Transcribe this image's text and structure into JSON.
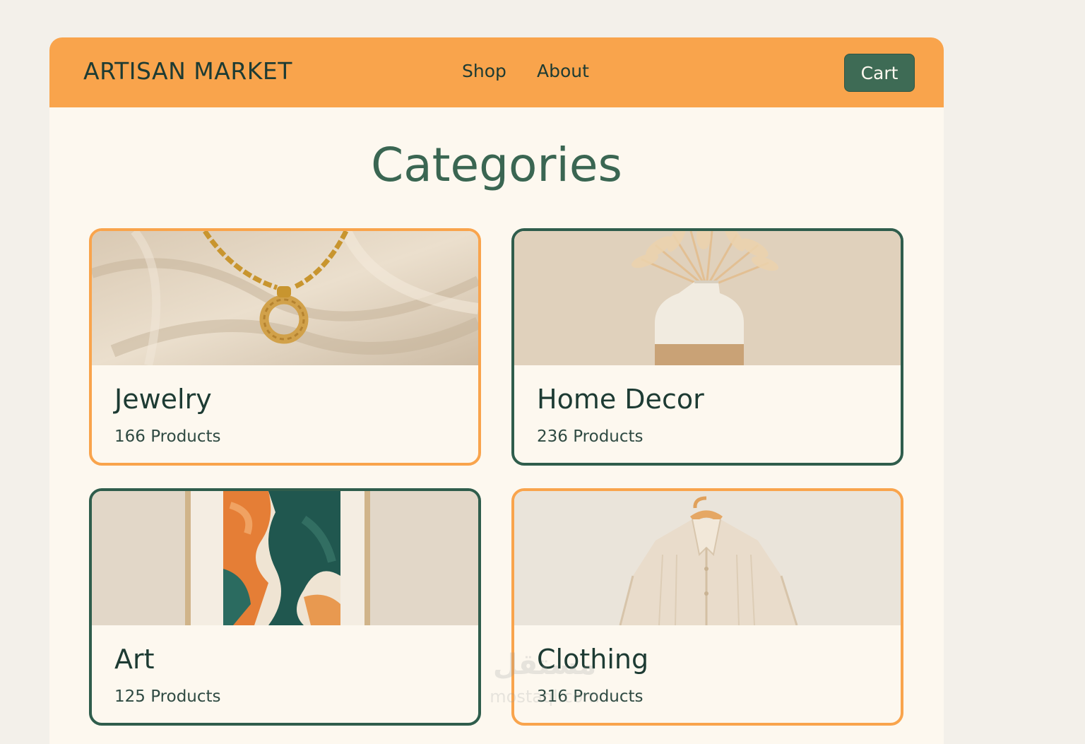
{
  "brand": "ARTISAN MARKET",
  "nav": {
    "shop": "Shop",
    "about": "About",
    "cart": "Cart"
  },
  "page_title": "Categories",
  "categories": [
    {
      "name": "Jewelry",
      "count": "166 Products",
      "accent": "#f9a44c",
      "image": "gold-pendant-necklace-on-linen"
    },
    {
      "name": "Home Decor",
      "count": "236 Products",
      "accent": "#2f5d4c",
      "image": "ceramic-vase-with-dried-pampas"
    },
    {
      "name": "Art",
      "count": "125 Products",
      "accent": "#2f5d4c",
      "image": "framed-abstract-painting"
    },
    {
      "name": "Clothing",
      "count": "316 Products",
      "accent": "#f9a44c",
      "image": "linen-shirt-on-wooden-hanger"
    }
  ],
  "colors": {
    "header": "#f9a44c",
    "primary_green": "#3e6b55",
    "background": "#fdf8ef",
    "text_dark": "#1d3b33"
  },
  "watermark": {
    "glyph": "مستقل",
    "url": "mostaql.com"
  }
}
